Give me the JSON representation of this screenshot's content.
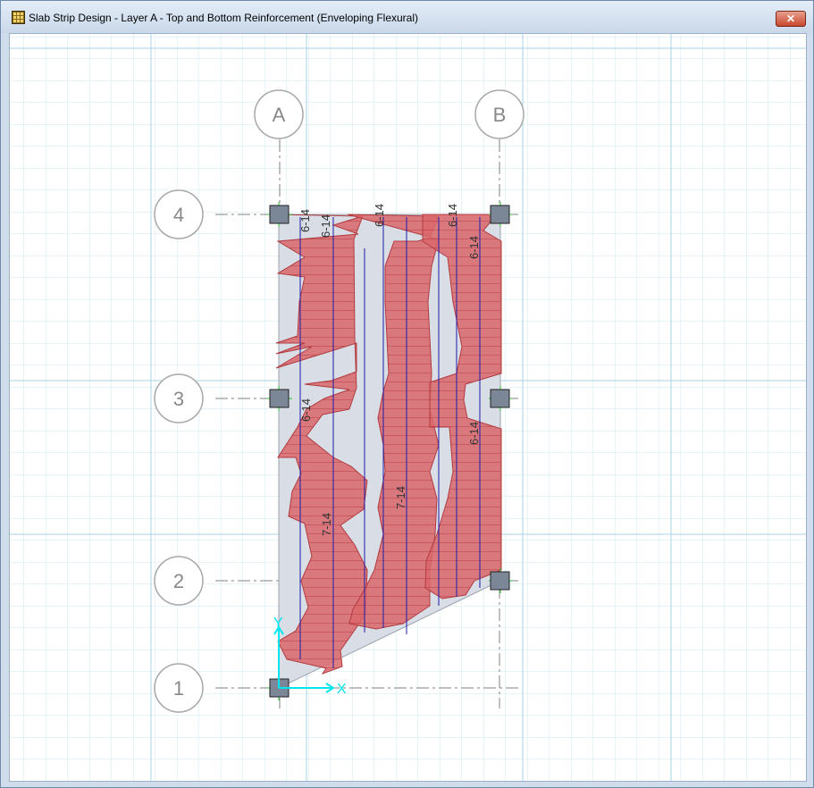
{
  "window": {
    "title": "Slab Strip Design - Layer A - Top and Bottom Reinforcement (Enveloping Flexural)",
    "close_glyph": "✕"
  },
  "grid_bubbles": {
    "columns": [
      "A",
      "B"
    ],
    "rows": [
      "4",
      "3",
      "2",
      "1"
    ]
  },
  "bar_labels": [
    "6-14",
    "6-14",
    "6-14",
    "6-14",
    "6-14",
    "6-14",
    "6-14",
    "7-14",
    "7-14"
  ],
  "axes": {
    "x": "X",
    "y": "Y"
  },
  "colors": {
    "rebar_fill": "#d9676b",
    "rebar_stroke": "#b23a3e",
    "slab_fill": "#d8dde6",
    "grid_line": "#bfe0ee",
    "strip_line": "#1c1caa",
    "column": "#7b8797",
    "axis": "#00e5ee",
    "support_cross": "#22cc22"
  }
}
